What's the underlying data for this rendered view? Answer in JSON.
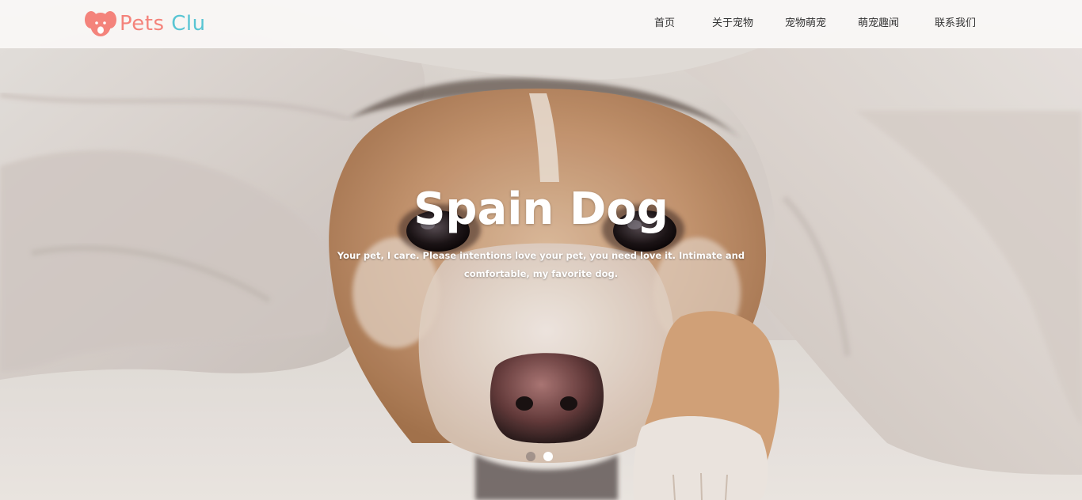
{
  "brand": {
    "logo_part1": "Pets",
    "logo_part2": "Clu",
    "logo_icon": "dog-face-icon",
    "colors": {
      "pink": "#f4837b",
      "teal": "#58c5d3"
    }
  },
  "nav": {
    "items": [
      {
        "label": "首页"
      },
      {
        "label": "关于宠物"
      },
      {
        "label": "宠物萌宠"
      },
      {
        "label": "萌宠趣闻"
      },
      {
        "label": "联系我们"
      }
    ]
  },
  "hero": {
    "title": "Spain Dog",
    "text": "Your pet, I care. Please intentions love your pet, you need love it. Intimate and comfortable, my favorite dog.",
    "slides_total": 2,
    "active_slide": 2
  }
}
